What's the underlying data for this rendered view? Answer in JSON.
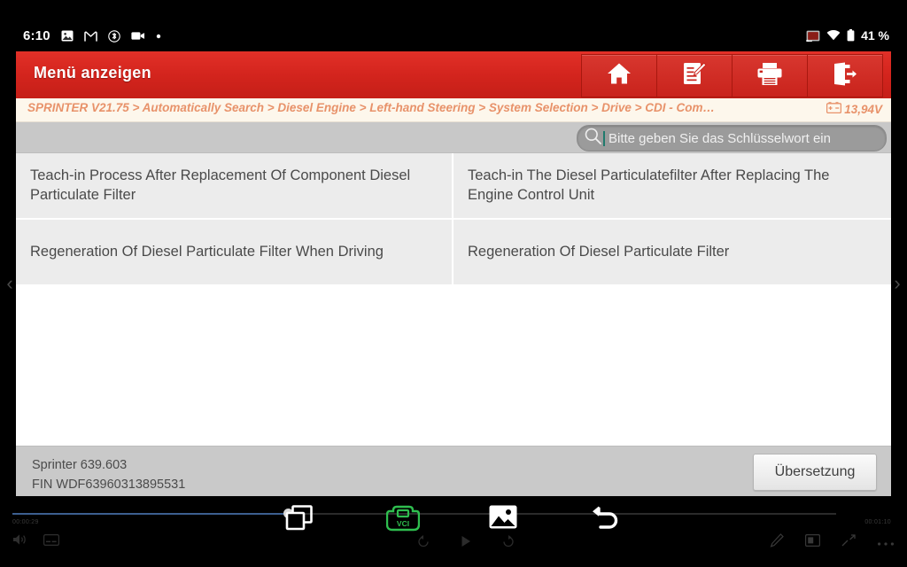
{
  "status_bar": {
    "time": "6:10",
    "battery_percent": "41 %",
    "left_icons": [
      "screenshot-icon",
      "gmail-icon",
      "bluetooth-icon",
      "screen-record-icon",
      "dot-icon"
    ],
    "right_icons": [
      "cast-icon",
      "wifi-icon",
      "battery-icon"
    ]
  },
  "app": {
    "header": {
      "title": "Menü anzeigen",
      "accent_color": "#d3241d",
      "tools": [
        {
          "name": "home-button",
          "icon": "home-icon"
        },
        {
          "name": "notes-button",
          "icon": "edit-note-icon"
        },
        {
          "name": "print-button",
          "icon": "printer-icon"
        },
        {
          "name": "exit-button",
          "icon": "exit-icon"
        }
      ]
    },
    "breadcrumb": {
      "text": "SPRINTER V21.75 > Automatically Search > Diesel Engine > Left-hand Steering > System Selection > Drive > CDI -  Com…",
      "color": "#e8926a",
      "voltage": "13,94V",
      "voltage_icon": "car-battery-icon"
    },
    "search": {
      "placeholder": "Bitte geben Sie das Schlüsselwort ein",
      "value": "",
      "icon": "search-icon"
    },
    "menu_items": [
      "Teach-in Process After Replacement Of Component Diesel Particulate Filter",
      "Teach-in The Diesel Particulatefilter After Replacing The Engine Control Unit",
      "Regeneration Of Diesel Particulate Filter When Driving",
      "Regeneration Of Diesel Particulate Filter"
    ],
    "footer": {
      "vehicle_model": "Sprinter 639.603",
      "vin": "FIN WDF63960313895531",
      "translate_label": "Übersetzung"
    },
    "side_nav": {
      "prev": "‹",
      "next": "›"
    }
  },
  "system_nav": {
    "items": [
      {
        "name": "recents-button",
        "icon": "recents-icon"
      },
      {
        "name": "vci-status-button",
        "icon": "vci-icon",
        "label": "VCI",
        "color": "#2fbe4f"
      },
      {
        "name": "gallery-button",
        "icon": "image-icon"
      },
      {
        "name": "back-button",
        "icon": "back-arrow-icon"
      }
    ],
    "media_overlay": {
      "elapsed": "00:00:29",
      "duration": "00:01:10"
    }
  }
}
